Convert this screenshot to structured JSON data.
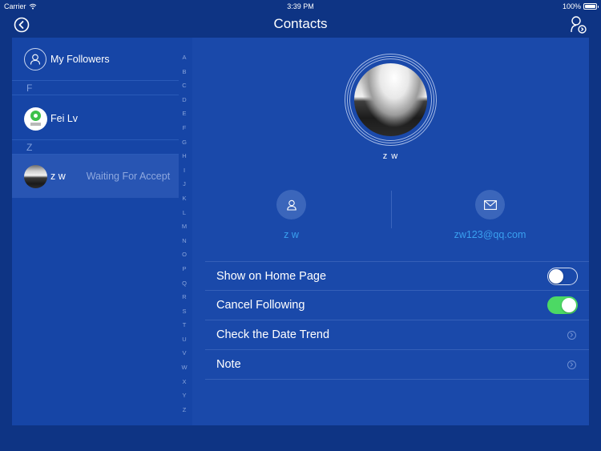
{
  "status_bar": {
    "carrier": "Carrier",
    "time": "3:39 PM",
    "battery": "100%",
    "battery_level": 1.0
  },
  "nav": {
    "title": "Contacts",
    "back_icon": "back-circle-icon",
    "add_icon": "add-contact-icon"
  },
  "left": {
    "followers_label": "My Followers",
    "sections": [
      {
        "letter": "F",
        "contacts": [
          {
            "name": "Fei Lv",
            "status": "",
            "avatar": "green-pin-logo",
            "selected": false
          }
        ]
      },
      {
        "letter": "Z",
        "contacts": [
          {
            "name": "z w",
            "status": "Waiting For Accept",
            "avatar": "landscape-photo",
            "selected": true
          }
        ]
      }
    ],
    "index_letters": [
      "A",
      "B",
      "C",
      "D",
      "E",
      "F",
      "G",
      "H",
      "I",
      "J",
      "K",
      "L",
      "M",
      "N",
      "O",
      "P",
      "Q",
      "R",
      "S",
      "T",
      "U",
      "V",
      "W",
      "X",
      "Y",
      "Z"
    ]
  },
  "detail": {
    "name": "z w",
    "info": {
      "username": "z w",
      "email": "zw123@qq.com"
    },
    "settings": [
      {
        "label": "Show on Home Page",
        "type": "toggle",
        "value": false
      },
      {
        "label": "Cancel Following",
        "type": "toggle",
        "value": true
      },
      {
        "label": "Check the Date Trend",
        "type": "link"
      },
      {
        "label": "Note",
        "type": "link"
      }
    ]
  },
  "colors": {
    "background": "#0e3484",
    "card": "#1848a8",
    "selected_row": "#2855b3",
    "toggle_on": "#4cd964",
    "info_text": "#3aa0f0"
  }
}
